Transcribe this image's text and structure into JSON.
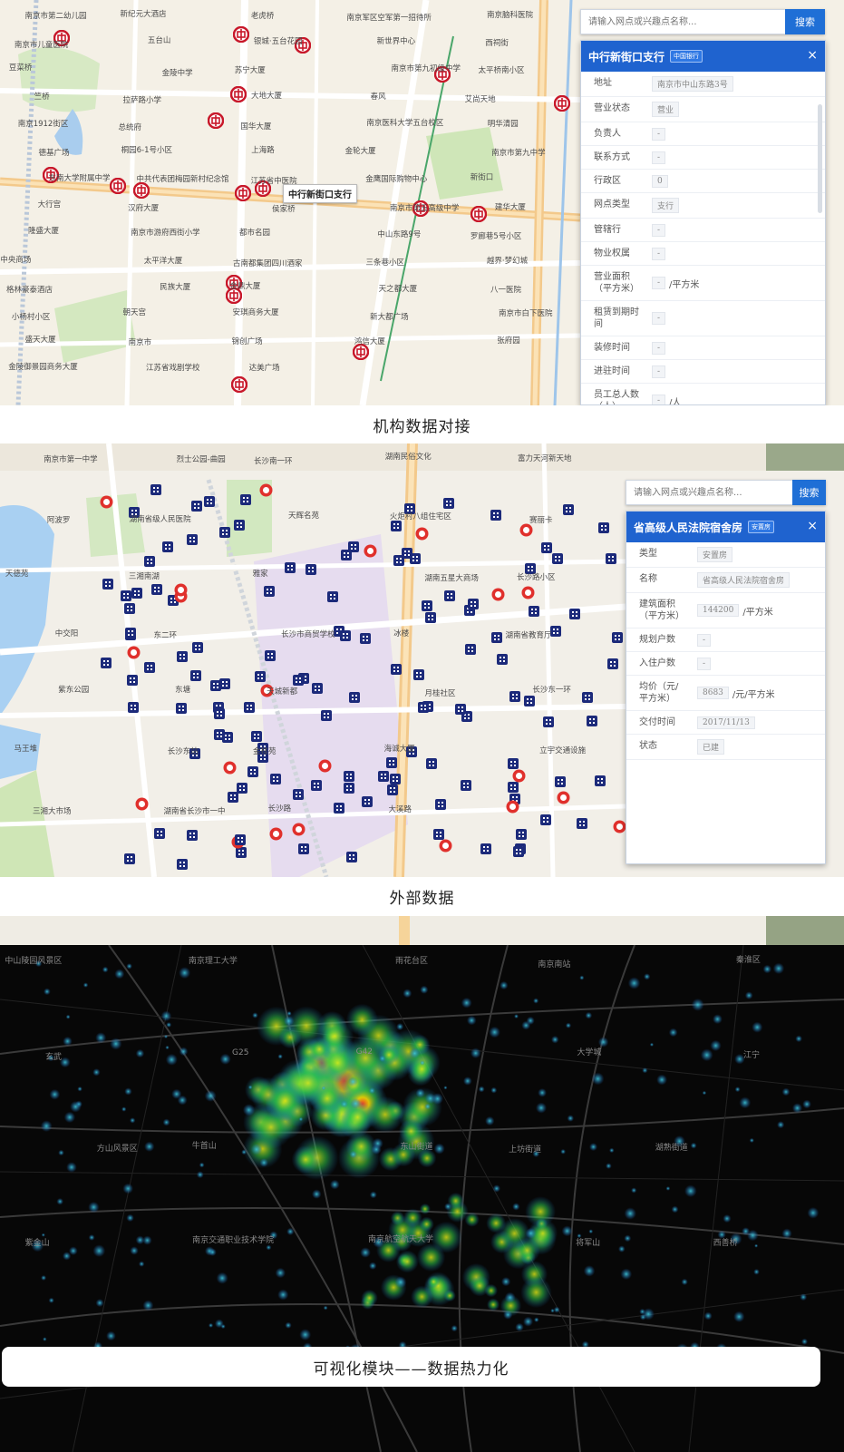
{
  "colors": {
    "accent": "#1f63cf",
    "button": "#1f6fd6",
    "bank_pin": "#c8182a",
    "house_pin": "#1c2a7a",
    "heat_hot": "#ff3b1f"
  },
  "panel1": {
    "search": {
      "placeholder": "请输入网点或兴趣点名称...",
      "button": "搜索"
    },
    "card": {
      "title": "中行新街口支行",
      "tag": "中国银行",
      "close": "×",
      "rows": [
        {
          "k": "地址",
          "v": "南京市中山东路3号",
          "u": ""
        },
        {
          "k": "营业状态",
          "v": "营业",
          "u": ""
        },
        {
          "k": "负责人",
          "v": "-",
          "u": ""
        },
        {
          "k": "联系方式",
          "v": "-",
          "u": ""
        },
        {
          "k": "行政区",
          "v": "0",
          "u": ""
        },
        {
          "k": "网点类型",
          "v": "支行",
          "u": ""
        },
        {
          "k": "管辖行",
          "v": "-",
          "u": ""
        },
        {
          "k": "物业权属",
          "v": "-",
          "u": ""
        },
        {
          "k": "营业面积（平方米）",
          "v": "-",
          "u": "/平方米"
        },
        {
          "k": "租赁到期时间",
          "v": "-",
          "u": ""
        },
        {
          "k": "装修时间",
          "v": "-",
          "u": ""
        },
        {
          "k": "进驻时间",
          "v": "-",
          "u": ""
        },
        {
          "k": "员工总人数（人）",
          "v": "-",
          "u": "/人"
        }
      ]
    },
    "callout": "中行新街口支行",
    "labels": [
      "南京市第二幼儿园",
      "新纪元大酒店",
      "老虎桥",
      "南京军区空军第一招待所",
      "南京脑科医院",
      "南京市儿童医院",
      "五台山",
      "银城·五台花园",
      "新世界中心",
      "西祠街",
      "豆菜桥",
      "金陵中学",
      "苏宁大厦",
      "南京市第九初级中学",
      "太平桥南小区",
      "竺桥",
      "拉萨路小学",
      "大地大厦",
      "春风",
      "艾尚天地",
      "南京1912街区",
      "总统府",
      "国华大厦",
      "南京医科大学五台校区",
      "明华清园",
      "德基广场",
      "桐园6-1号小区",
      "上海路",
      "金轮大厦",
      "南京市第九中学",
      "东南大学附属中学",
      "中共代表团梅园新村纪念馆",
      "江苏省中医院",
      "金鹰国际购物中心",
      "新街口",
      "大行宫",
      "汉府大厦",
      "侯家桥",
      "南京市第五高级中学",
      "建华大厦",
      "隆盛大厦",
      "南京市游府西街小学",
      "都市名园",
      "中山东路9号",
      "罗廊巷5号小区",
      "中央商场",
      "太平洋大厦",
      "古南都集团四川酒家",
      "三条巷小区",
      "越界·梦幻城",
      "格林豪泰酒店",
      "民族大厦",
      "金鼎大厦",
      "天之都大厦",
      "八一医院",
      "小杨村小区",
      "朝天宫",
      "安琪商务大厦",
      "新大都广场",
      "南京市白下医院",
      "盛天大厦",
      "南京市",
      "锦创广场",
      "鸿信大厦",
      "张府园",
      "金陵御景园商务大厦",
      "江苏省戏剧学校",
      "达美广场"
    ]
  },
  "caption1": "机构数据对接",
  "panel2": {
    "search": {
      "placeholder": "请输入网点或兴趣点名称...",
      "button": "搜索"
    },
    "card": {
      "title": "省高级人民法院宿舍房",
      "tag": "安置房",
      "close": "×",
      "rows": [
        {
          "k": "类型",
          "v": "安置房",
          "u": ""
        },
        {
          "k": "名称",
          "v": "省高级人民法院宿舍房",
          "u": ""
        },
        {
          "k": "建筑面积（平方米）",
          "v": "144200",
          "u": "/平方米"
        },
        {
          "k": "规划户数",
          "v": "-",
          "u": ""
        },
        {
          "k": "入住户数",
          "v": "-",
          "u": ""
        },
        {
          "k": "均价（元/平方米）",
          "v": "8683",
          "u": "/元/平方米"
        },
        {
          "k": "交付时间",
          "v": "2017/11/13",
          "u": ""
        },
        {
          "k": "状态",
          "v": "已建",
          "u": ""
        }
      ]
    },
    "labels": [
      "南京市第一中学",
      "烈士公园-曲园",
      "长沙南一环",
      "湖南民俗文化",
      "富力天河新天地",
      "阿波罗",
      "湖南省级人民医院",
      "天辉名苑",
      "火炬村八组住宅区",
      "赛丽卡",
      "天德苑",
      "三湘南湖",
      "雅家",
      "湖南五星大商场",
      "长沙路小区",
      "中交阳",
      "东二环",
      "长沙市商贸学校",
      "冰楼",
      "湖南省教育厅",
      "紫东公园",
      "东塘",
      "天城新都",
      "月桂社区",
      "长沙东一环",
      "马王堆",
      "长沙东站",
      "金桂苑",
      "海诚大厦",
      "立宇交通设施",
      "三湘大市场",
      "湖南省长沙市一中",
      "长沙路",
      "大溪路"
    ]
  },
  "caption2": "外部数据",
  "panel3": {
    "labels": [
      "中山陵园风景区",
      "南京理工大学",
      "雨花台区",
      "南京南站",
      "秦淮区",
      "玄武",
      "G25",
      "G42",
      "大学城",
      "江宁",
      "方山风景区",
      "牛首山",
      "东山街道",
      "上坊街道",
      "湖熟街道",
      "紫金山",
      "南京交通职业技术学院",
      "南京航空航天大学",
      "将军山",
      "西善桥"
    ]
  },
  "caption3": "可视化模块——数据热力化"
}
